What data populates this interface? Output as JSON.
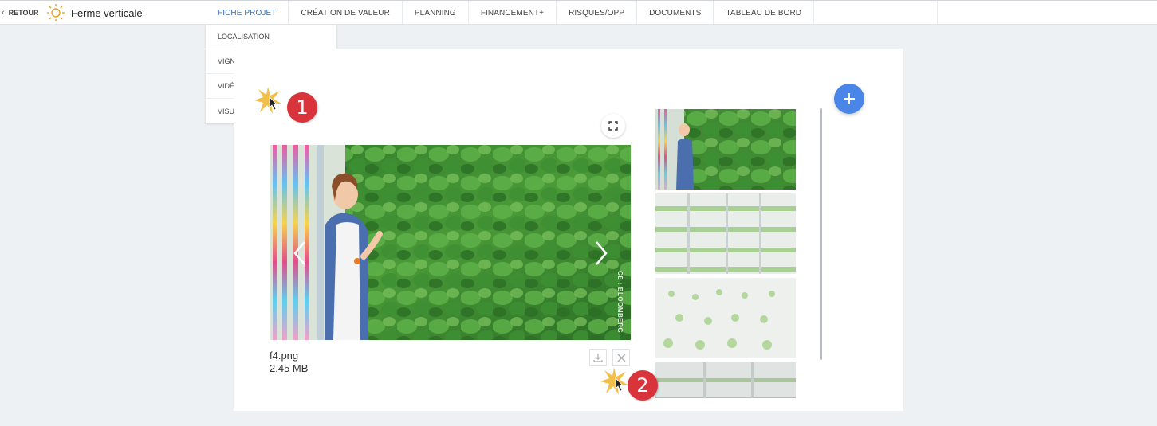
{
  "header": {
    "back_label": "RETOUR",
    "project_title": "Ferme verticale",
    "logo_icon": "sun-icon"
  },
  "tabs": [
    {
      "label": "FICHE PROJET",
      "active": true
    },
    {
      "label": "CRÉATION DE VALEUR"
    },
    {
      "label": "PLANNING"
    },
    {
      "label": "FINANCEMENT+"
    },
    {
      "label": "RISQUES/OPP"
    },
    {
      "label": "DOCUMENTS"
    },
    {
      "label": "TABLEAU DE BORD"
    }
  ],
  "dropdown": {
    "items": [
      "LOCALISATION",
      "VIGNETTE",
      "VIDÉO",
      "VISUELS"
    ]
  },
  "viewer": {
    "file_name": "f4.png",
    "file_size": "2.45 MB",
    "image_credit": "CE : BLOOMBERG"
  },
  "annotations": {
    "step1": "1",
    "step2": "2"
  },
  "colors": {
    "accent": "#4a86e8",
    "active_tab": "#3e6fb0",
    "badge": "#d9343c"
  }
}
